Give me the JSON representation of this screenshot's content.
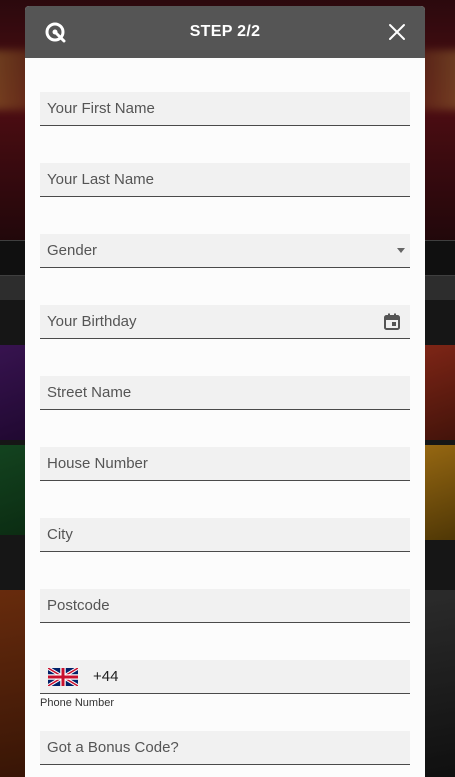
{
  "header": {
    "title": "STEP 2/2",
    "logo_icon": "brand-logo-icon",
    "close_icon": "close-icon"
  },
  "form": {
    "first_name": {
      "placeholder": "Your First Name"
    },
    "last_name": {
      "placeholder": "Your Last Name"
    },
    "gender": {
      "placeholder": "Gender",
      "icon": "chevron-down-icon"
    },
    "birthday": {
      "placeholder": "Your Birthday",
      "icon": "calendar-icon"
    },
    "street_name": {
      "placeholder": "Street Name"
    },
    "house_number": {
      "placeholder": "House Number"
    },
    "city": {
      "placeholder": "City"
    },
    "postcode": {
      "placeholder": "Postcode"
    },
    "phone": {
      "label": "Phone Number",
      "dial_code": "+44",
      "flag_icon": "uk-flag-icon"
    },
    "bonus_code": {
      "placeholder": "Got a Bonus Code?"
    }
  },
  "colors": {
    "header_bg": "#555555",
    "modal_bg": "#fcfcfc",
    "field_bg": "#f1f1f1",
    "field_underline": "#4a4a4a"
  }
}
